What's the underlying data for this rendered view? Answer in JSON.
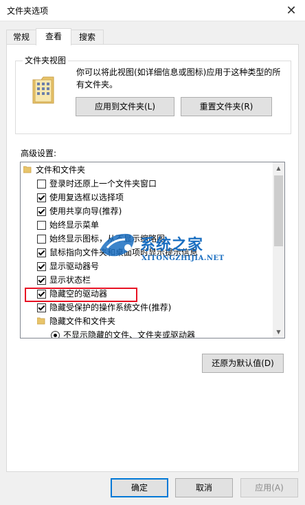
{
  "window": {
    "title": "文件夹选项",
    "close_symbol": "✕"
  },
  "tabs": [
    {
      "label": "常规",
      "active": false
    },
    {
      "label": "查看",
      "active": true
    },
    {
      "label": "搜索",
      "active": false
    }
  ],
  "folder_view": {
    "group_label": "文件夹视图",
    "description": "你可以将此视图(如详细信息或图标)应用于这种类型的所有文件夹。",
    "apply_button": "应用到文件夹(L)",
    "reset_button": "重置文件夹(R)"
  },
  "advanced": {
    "label": "高级设置:",
    "items": [
      {
        "type": "folder",
        "label": "文件和文件夹"
      },
      {
        "type": "checkbox",
        "checked": false,
        "label": "登录时还原上一个文件夹窗口"
      },
      {
        "type": "checkbox",
        "checked": true,
        "label": "使用复选框以选择项"
      },
      {
        "type": "checkbox",
        "checked": true,
        "label": "使用共享向导(推荐)"
      },
      {
        "type": "checkbox",
        "checked": false,
        "label": "始终显示菜单"
      },
      {
        "type": "checkbox",
        "checked": false,
        "label": "始终显示图标，从不显示缩略图"
      },
      {
        "type": "checkbox",
        "checked": true,
        "label": "鼠标指向文件夹和桌面项时显示提示信息"
      },
      {
        "type": "checkbox",
        "checked": true,
        "label": "显示驱动器号"
      },
      {
        "type": "checkbox",
        "checked": true,
        "label": "显示状态栏"
      },
      {
        "type": "checkbox",
        "checked": true,
        "label": "隐藏空的驱动器"
      },
      {
        "type": "checkbox",
        "checked": true,
        "label": "隐藏受保护的操作系统文件(推荐)"
      },
      {
        "type": "folder",
        "label": "隐藏文件和文件夹"
      },
      {
        "type": "radio",
        "checked": true,
        "label": "不显示隐藏的文件、文件夹或驱动器"
      }
    ],
    "restore_button": "还原为默认值(D)"
  },
  "footer": {
    "ok": "确定",
    "cancel": "取消",
    "apply": "应用(A)"
  },
  "watermark": {
    "text": "系统之家",
    "url": "XITONGZHIJIA.NET"
  },
  "colors": {
    "highlight_box": "#e81123",
    "watermark": "#1b6fc1"
  }
}
